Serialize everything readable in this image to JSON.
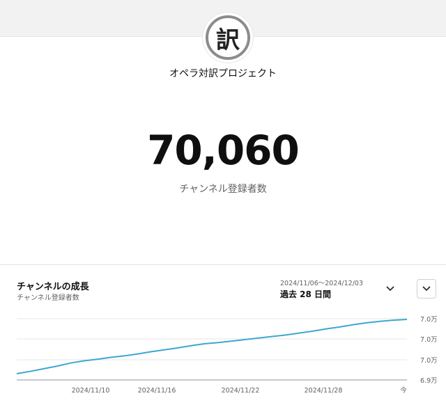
{
  "channel": {
    "name": "オペラ対訳プロジェクト",
    "avatar_char": "訳",
    "subscriber_count": "70,060",
    "subscriber_label": "チャンネル登録者数"
  },
  "growth_card": {
    "title": "チャンネルの成長",
    "subtitle": "チャンネル登録者数",
    "date_range": "2024/11/06～2024/12/03",
    "period": "過去 28 日間",
    "period_icon": "chevron-down-icon",
    "expand_icon": "chevron-down-icon"
  },
  "chart_data": {
    "type": "line",
    "x_tick_labels": [
      "2024/11/10",
      "2024/11/16",
      "2024/11/22",
      "2024/11/28",
      "今"
    ],
    "y_tick_labels": [
      "7.0万",
      "7.0万",
      "7.0万",
      "6.9万"
    ],
    "grid": true,
    "line_color": "#3ea6d2",
    "series": [
      {
        "values": [
          0.0,
          0.06,
          0.13,
          0.2,
          0.28,
          0.34,
          0.38,
          0.43,
          0.47,
          0.52,
          0.58,
          0.63,
          0.68,
          0.74,
          0.79,
          0.82,
          0.86,
          0.9,
          0.94,
          0.98,
          1.02,
          1.07,
          1.12,
          1.18,
          1.23,
          1.29,
          1.34,
          1.38,
          1.41,
          1.43
        ]
      }
    ]
  }
}
